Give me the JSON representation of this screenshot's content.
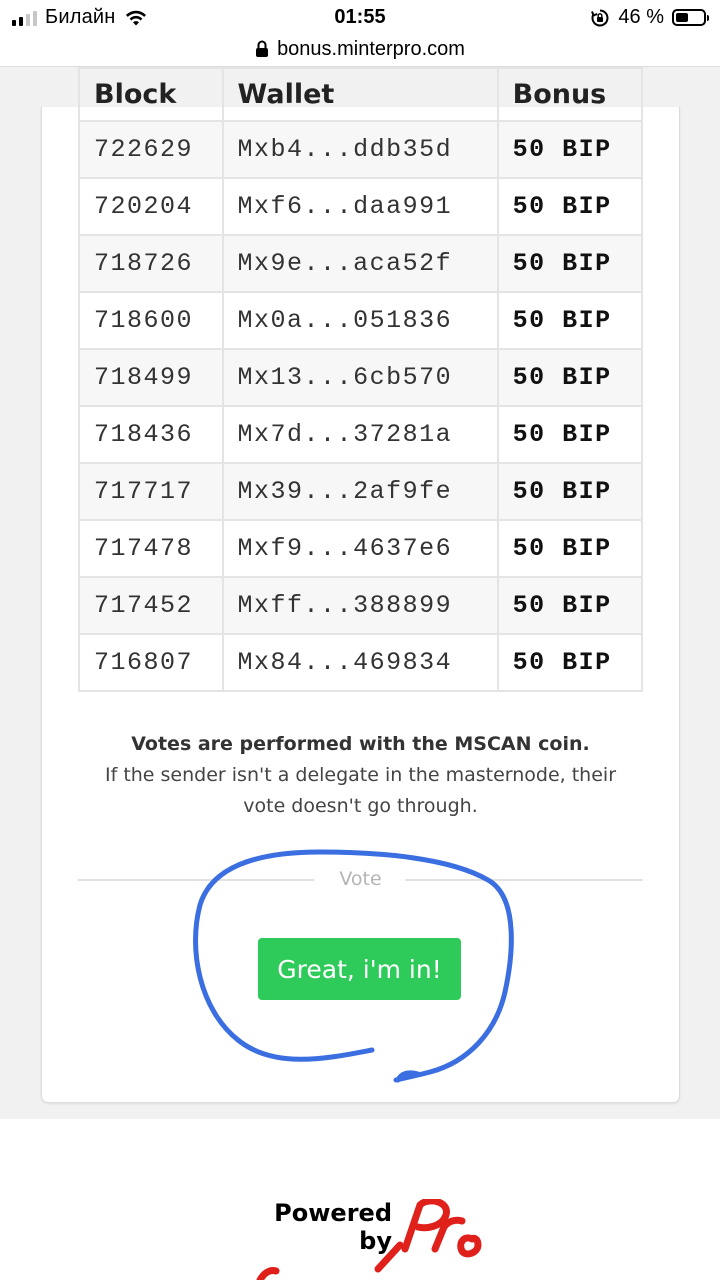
{
  "status_bar": {
    "carrier": "Билайн",
    "time": "01:55",
    "battery_percent": "46 %",
    "battery_level": 0.46,
    "signal_bars": 2
  },
  "browser": {
    "url": "bonus.minterpro.com"
  },
  "table": {
    "headers": [
      "Block",
      "Wallet",
      "Bonus"
    ],
    "rows": [
      {
        "block": "722629",
        "wallet": "Mxb4...ddb35d",
        "bonus": "50 BIP"
      },
      {
        "block": "720204",
        "wallet": "Mxf6...daa991",
        "bonus": "50 BIP"
      },
      {
        "block": "718726",
        "wallet": "Mx9e...aca52f",
        "bonus": "50 BIP"
      },
      {
        "block": "718600",
        "wallet": "Mx0a...051836",
        "bonus": "50 BIP"
      },
      {
        "block": "718499",
        "wallet": "Mx13...6cb570",
        "bonus": "50 BIP"
      },
      {
        "block": "718436",
        "wallet": "Mx7d...37281a",
        "bonus": "50 BIP"
      },
      {
        "block": "717717",
        "wallet": "Mx39...2af9fe",
        "bonus": "50 BIP"
      },
      {
        "block": "717478",
        "wallet": "Mxf9...4637e6",
        "bonus": "50 BIP"
      },
      {
        "block": "717452",
        "wallet": "Mxff...388899",
        "bonus": "50 BIP"
      },
      {
        "block": "716807",
        "wallet": "Mx84...469834",
        "bonus": "50 BIP"
      }
    ]
  },
  "notes": {
    "strong": "Votes are performed with the MSCAN coin.",
    "line1": "If the sender isn't a delegate in the masternode, their",
    "line2": "vote doesn't go through."
  },
  "vote": {
    "divider_label": "Vote",
    "button_label": "Great, i'm in!"
  },
  "footer": {
    "powered_line1": "Powered",
    "powered_line2": "by",
    "logo_text": "MinterPro"
  },
  "colors": {
    "button_green": "#2fcb5a",
    "annotation_blue": "#3b6ee0",
    "logo_red": "#e0201b"
  }
}
